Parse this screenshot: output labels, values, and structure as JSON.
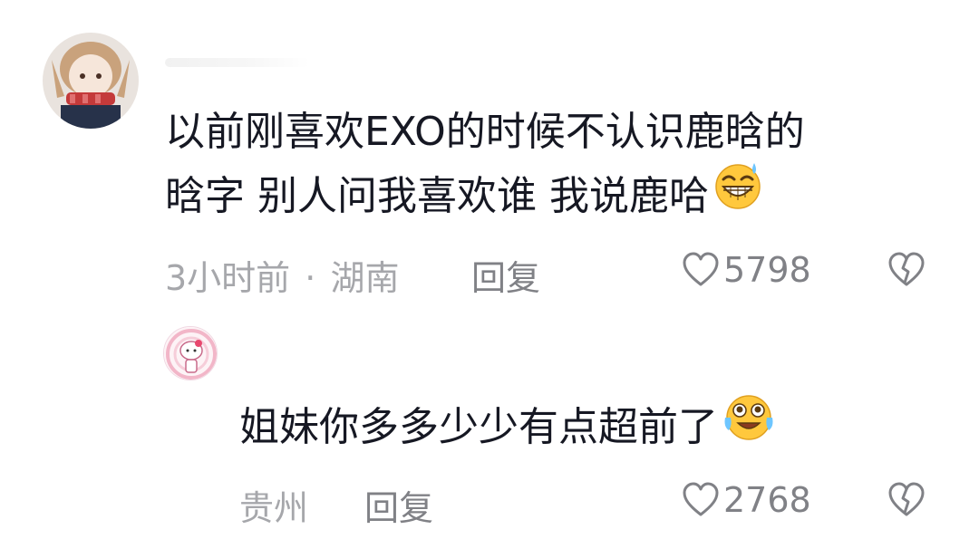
{
  "comment": {
    "text_line1": "以前刚喜欢EXO的时候不认识鹿晗的",
    "text_line2": "晗字  别人问我喜欢谁   我说鹿哈",
    "time": "3小时前",
    "separator": "·",
    "location": "湖南",
    "reply_label": "回复",
    "like_count": "5798",
    "emoji": "grinning-sweat-emoji"
  },
  "reply": {
    "text": "姐妹你多多少少有点超前了",
    "location": "贵州",
    "reply_label": "回复",
    "like_count": "2768",
    "emoji": "pleading-laugh-emoji"
  },
  "colors": {
    "text": "#161823",
    "meta": "#a6a7ab",
    "action": "#808186"
  }
}
